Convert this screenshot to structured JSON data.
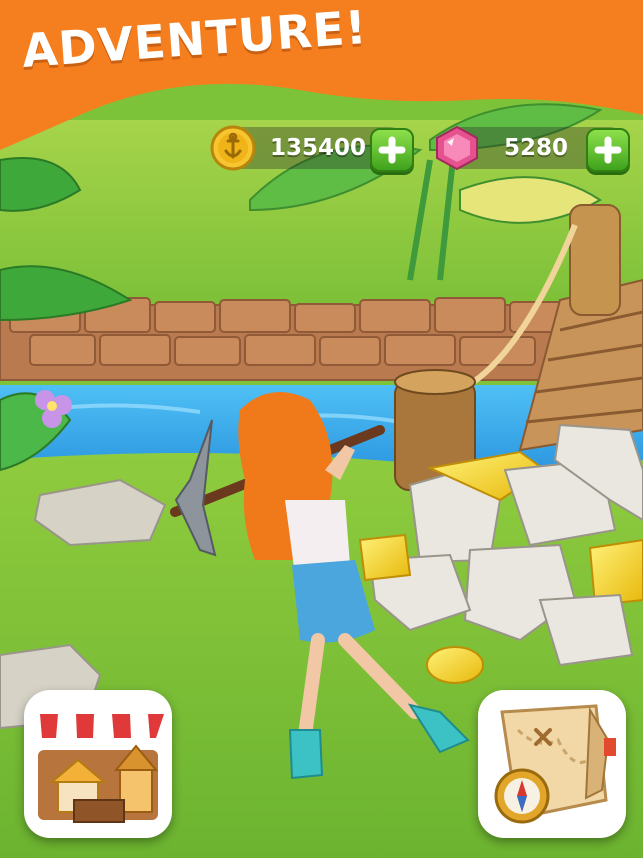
{
  "banner": {
    "title": "ADVENTURE!"
  },
  "currencies": {
    "coins": {
      "value": "135400",
      "icon": "anchor-coin-icon",
      "add_icon": "plus-icon"
    },
    "gems": {
      "value": "5280",
      "icon": "pink-gem-icon",
      "add_icon": "plus-icon"
    }
  },
  "buttons": {
    "shop": {
      "icon": "market-stall-icon"
    },
    "map": {
      "icon": "treasure-map-compass-icon"
    }
  },
  "colors": {
    "banner_orange": "#f57f1f",
    "grass": "#7cc33a",
    "water": "#38a8ea",
    "plus_green": "#4fb52a",
    "gold": "#f4d21a"
  }
}
